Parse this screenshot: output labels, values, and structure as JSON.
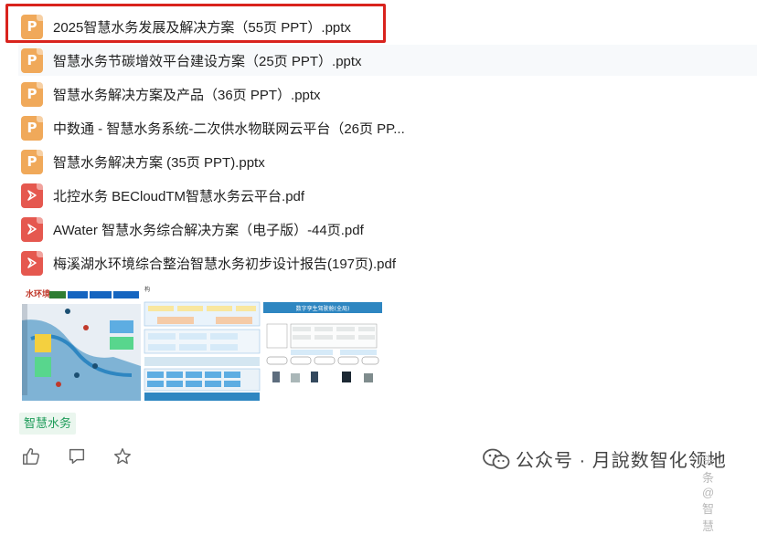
{
  "files": [
    {
      "type": "ppt",
      "icon_letter": "P",
      "name": "2025智慧水务发展及解决方案（55页 PPT）.pptx"
    },
    {
      "type": "ppt",
      "icon_letter": "P",
      "name": "智慧水务节碳增效平台建设方案（25页 PPT）.pptx"
    },
    {
      "type": "ppt",
      "icon_letter": "P",
      "name": "智慧水务解决方案及产品（36页 PPT）.pptx"
    },
    {
      "type": "ppt",
      "icon_letter": "P",
      "name": "中数通 - 智慧水务系统-二次供水物联网云平台（26页 PP..."
    },
    {
      "type": "ppt",
      "icon_letter": "P",
      "name": "智慧水务解决方案 (35页 PPT).pptx"
    },
    {
      "type": "pdf",
      "icon_letter": "",
      "name": "北控水务 BECloudTM智慧水务云平台.pdf"
    },
    {
      "type": "pdf",
      "icon_letter": "",
      "name": "AWater 智慧水务综合解决方案（电子版）-44页.pdf"
    },
    {
      "type": "pdf",
      "icon_letter": "",
      "name": "梅溪湖水环境综合整治智慧水务初步设计报告(197页).pdf"
    }
  ],
  "thumbnails": {
    "thumb1_title": "水环境",
    "thumb3_title": "数字孪生驾驶舱(全局)"
  },
  "tag": "智慧水务",
  "watermark": {
    "text": "公众号 · 月說数智化领地",
    "ghost": "头条 @智慧"
  },
  "colors": {
    "ppt_icon": "#f0a95a",
    "pdf_icon": "#e5584f",
    "highlight": "#d9231d",
    "tag_bg": "#eaf6ee",
    "tag_text": "#1f9c5a"
  }
}
